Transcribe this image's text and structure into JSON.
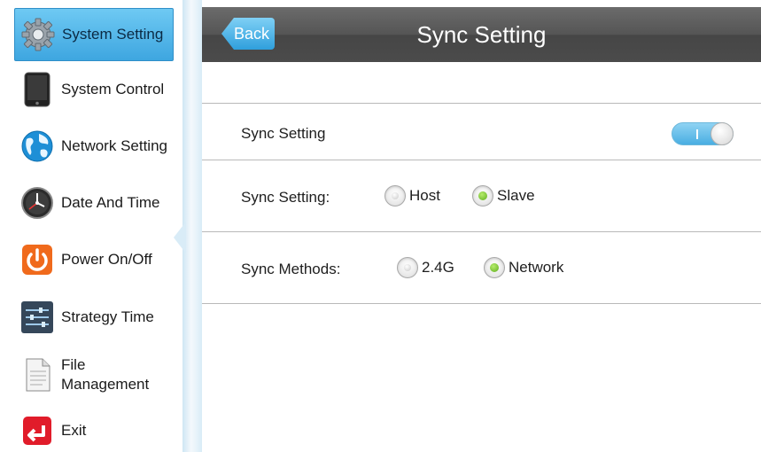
{
  "sidebar": {
    "items": [
      {
        "label": "System Setting",
        "icon": "gear-icon",
        "active": true
      },
      {
        "label": "System Control",
        "icon": "tablet-icon",
        "active": false
      },
      {
        "label": "Network Setting",
        "icon": "globe-icon",
        "active": false
      },
      {
        "label": "Date And Time",
        "icon": "clock-icon",
        "active": false
      },
      {
        "label": "Power On/Off",
        "icon": "power-icon",
        "active": false
      },
      {
        "label": "Strategy Time",
        "icon": "sliders-icon",
        "active": false
      },
      {
        "label": "File\nManagement",
        "icon": "document-icon",
        "active": false
      },
      {
        "label": "Exit",
        "icon": "exit-icon",
        "active": false
      }
    ]
  },
  "header": {
    "back_label": "Back",
    "title": "Sync Setting"
  },
  "settings": {
    "sync_switch": {
      "label": "Sync Setting",
      "on": true
    },
    "sync_mode": {
      "label": "Sync Setting:",
      "options": [
        {
          "label": "Host",
          "selected": false
        },
        {
          "label": "Slave",
          "selected": true
        }
      ]
    },
    "sync_method": {
      "label": "Sync Methods:",
      "options": [
        {
          "label": "2.4G",
          "selected": false
        },
        {
          "label": "Network",
          "selected": true
        }
      ]
    }
  },
  "colors": {
    "accent": "#3ea6e0",
    "header": "#4f4f4f",
    "radio_selected": "#6cc02a"
  }
}
